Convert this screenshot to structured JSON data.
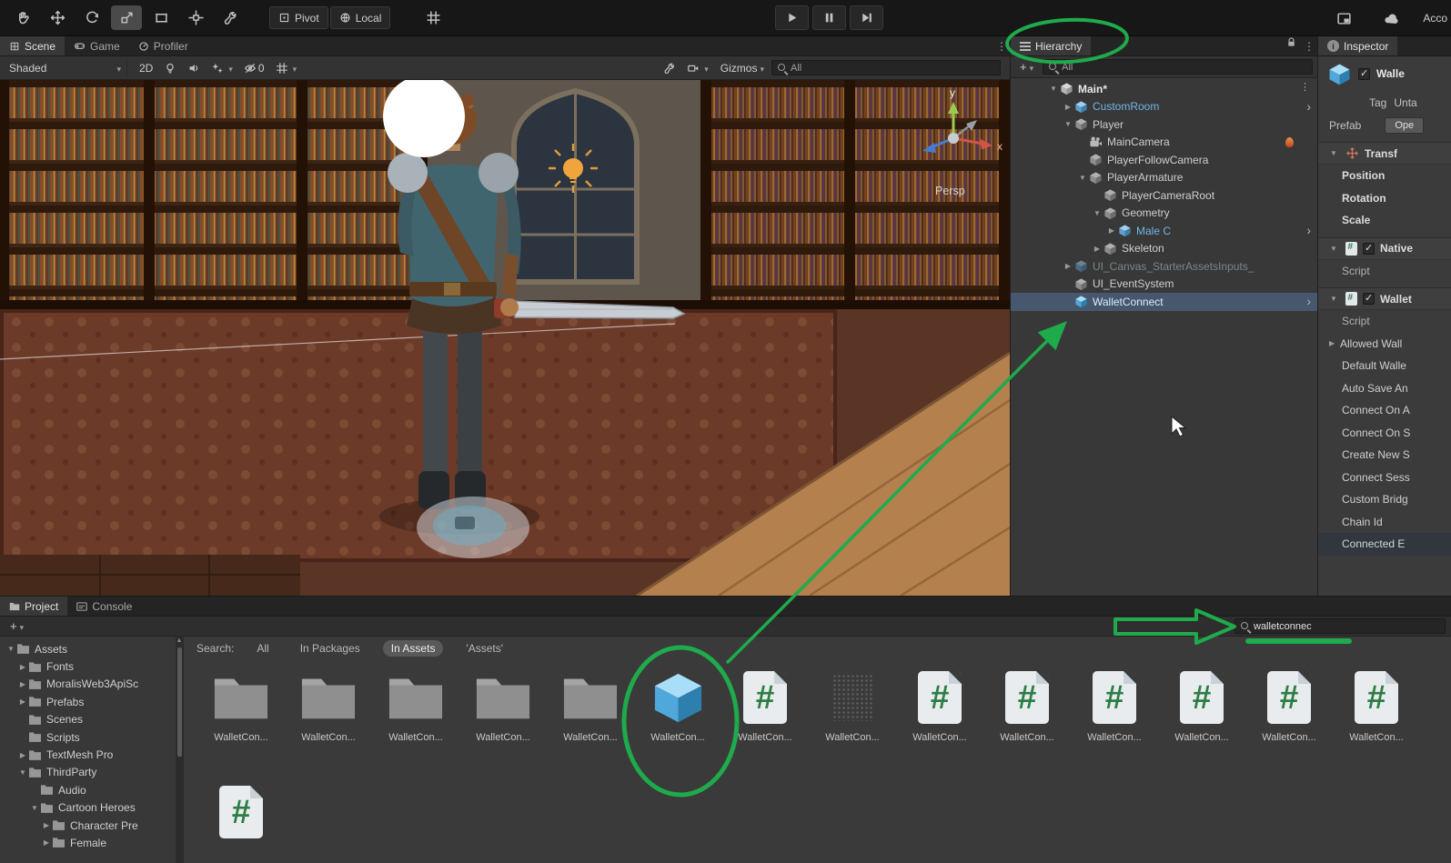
{
  "topbar": {
    "tools": [
      "hand-tool",
      "move-tool",
      "rotate-tool",
      "scale-tool",
      "rect-tool",
      "transform-tool",
      "custom-tool"
    ],
    "pivot_label": "Pivot",
    "local_label": "Local",
    "account_label": "Acco"
  },
  "scene_panel": {
    "tabs": [
      {
        "label": "Scene",
        "active": true
      },
      {
        "label": "Game",
        "active": false
      },
      {
        "label": "Profiler",
        "active": false
      }
    ],
    "toolbar": {
      "shading_mode": "Shaded",
      "mode_2d_label": "2D",
      "hidden_count": "0",
      "gizmos_label": "Gizmos",
      "search_value": "All"
    },
    "viewport": {
      "persp_label": "Persp",
      "axis_x_label": "x",
      "axis_y_label": "y"
    }
  },
  "hierarchy": {
    "tab_title": "Hierarchy",
    "add_button": "+",
    "search_value": "All",
    "items": [
      {
        "label": "Main*",
        "depth": 0,
        "expand": "open",
        "icon": "scene",
        "menu": true
      },
      {
        "label": "CustomRoom",
        "depth": 1,
        "expand": "closed",
        "icon": "prefab",
        "style": "prefab",
        "chevron": true
      },
      {
        "label": "Player",
        "depth": 1,
        "expand": "open",
        "icon": "gameobject"
      },
      {
        "label": "MainCamera",
        "depth": 2,
        "icon": "camera",
        "badge": "flame"
      },
      {
        "label": "PlayerFollowCamera",
        "depth": 2,
        "icon": "gameobject"
      },
      {
        "label": "PlayerArmature",
        "depth": 2,
        "expand": "open",
        "icon": "gameobject"
      },
      {
        "label": "PlayerCameraRoot",
        "depth": 3,
        "icon": "gameobject"
      },
      {
        "label": "Geometry",
        "depth": 3,
        "expand": "open",
        "icon": "gameobject"
      },
      {
        "label": "Male C",
        "depth": 4,
        "expand": "closed",
        "icon": "prefab",
        "style": "prefab",
        "chevron": true
      },
      {
        "label": "Skeleton",
        "depth": 3,
        "expand": "closed",
        "icon": "gameobject"
      },
      {
        "label": "UI_Canvas_StarterAssetsInputs_",
        "depth": 1,
        "expand": "closed",
        "icon": "prefab",
        "disabled": true
      },
      {
        "label": "UI_EventSystem",
        "depth": 1,
        "icon": "gameobject"
      },
      {
        "label": "WalletConnect",
        "depth": 1,
        "icon": "package",
        "selected": true,
        "chevron": true
      }
    ]
  },
  "inspector": {
    "tab_title": "Inspector",
    "object_name": "Walle",
    "tag_label": "Tag",
    "tag_value": "Unta",
    "prefab_label": "Prefab",
    "prefab_button_label": "Ope",
    "transform_title": "Transf",
    "transform_fields": [
      {
        "label": "Position"
      },
      {
        "label": "Rotation"
      },
      {
        "label": "Scale"
      }
    ],
    "native_title": "Native",
    "native_script_label": "Script",
    "wallet_title": "Wallet",
    "wallet_script_label": "Script",
    "wallet_fields": [
      {
        "label": "Allowed Wall",
        "foldout": true
      },
      {
        "label": "Default Walle"
      },
      {
        "label": "Auto Save An"
      },
      {
        "label": "Connect On A"
      },
      {
        "label": "Connect On S"
      },
      {
        "label": "Create New S"
      },
      {
        "label": "Connect Sess"
      },
      {
        "label": "Custom Bridg"
      },
      {
        "label": "Chain Id"
      },
      {
        "label": "Connected E",
        "band": true
      }
    ]
  },
  "project": {
    "tabs": [
      {
        "label": "Project",
        "active": true
      },
      {
        "label": "Console",
        "active": false
      }
    ],
    "add_button": "+",
    "search_value": "walletconnec",
    "folders": [
      {
        "label": "Assets",
        "depth": 0,
        "expand": "open"
      },
      {
        "label": "Fonts",
        "depth": 1,
        "expand": "closed"
      },
      {
        "label": "MoralisWeb3ApiSc",
        "depth": 1,
        "expand": "closed"
      },
      {
        "label": "Prefabs",
        "depth": 1,
        "expand": "closed"
      },
      {
        "label": "Scenes",
        "depth": 1
      },
      {
        "label": "Scripts",
        "depth": 1
      },
      {
        "label": "TextMesh Pro",
        "depth": 1,
        "expand": "closed"
      },
      {
        "label": "ThirdParty",
        "depth": 1,
        "expand": "open"
      },
      {
        "label": "Audio",
        "depth": 2
      },
      {
        "label": "Cartoon Heroes",
        "depth": 2,
        "expand": "open"
      },
      {
        "label": "Character Pre",
        "depth": 3,
        "expand": "closed"
      },
      {
        "label": "Female",
        "depth": 3,
        "expand": "closed"
      }
    ],
    "filter_bar": {
      "search_label": "Search:",
      "scopes": [
        {
          "label": "All",
          "active": false
        },
        {
          "label": "In Packages",
          "active": false
        },
        {
          "label": "In Assets",
          "active": true
        },
        {
          "label": "'Assets'",
          "active": false
        }
      ]
    },
    "assets": [
      {
        "label": "WalletCon...",
        "icon": "folder"
      },
      {
        "label": "WalletCon...",
        "icon": "folder"
      },
      {
        "label": "WalletCon...",
        "icon": "folder"
      },
      {
        "label": "WalletCon...",
        "icon": "folder"
      },
      {
        "label": "WalletCon...",
        "icon": "folder"
      },
      {
        "label": "WalletCon...",
        "icon": "package",
        "annotated": true
      },
      {
        "label": "WalletCon...",
        "icon": "script"
      },
      {
        "label": "WalletCon...",
        "icon": "faded"
      },
      {
        "label": "WalletCon...",
        "icon": "script"
      },
      {
        "label": "WalletCon...",
        "icon": "script"
      },
      {
        "label": "WalletCon...",
        "icon": "script"
      },
      {
        "label": "WalletCon...",
        "icon": "script"
      },
      {
        "label": "WalletCon...",
        "icon": "script"
      },
      {
        "label": "WalletCon...",
        "icon": "script"
      },
      {
        "label": "",
        "icon": "script"
      }
    ]
  },
  "annotations": {
    "color": "#1faa4b"
  }
}
